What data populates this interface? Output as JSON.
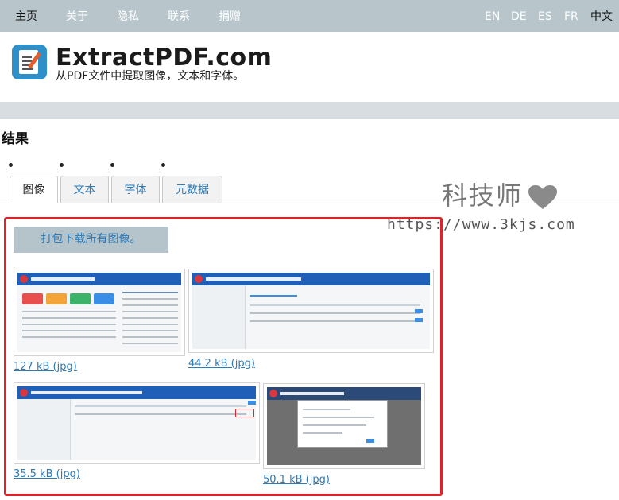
{
  "nav": {
    "left": [
      "主页",
      "关于",
      "隐私",
      "联系",
      "捐赠"
    ],
    "languages": [
      "EN",
      "DE",
      "ES",
      "FR",
      "中文"
    ]
  },
  "header": {
    "title": "ExtractPDF.com",
    "subtitle": "从PDF文件中提取图像，文本和字体。"
  },
  "results": {
    "heading": "结果",
    "tabs": [
      "图像",
      "文本",
      "字体",
      "元数据"
    ],
    "download_all_label": "打包下载所有图像。",
    "images": [
      {
        "size_label": "127 kB (jpg)"
      },
      {
        "size_label": "44.2 kB (jpg)"
      },
      {
        "size_label": "35.5 kB (jpg)"
      },
      {
        "size_label": "50.1 kB (jpg)"
      }
    ]
  },
  "watermark": {
    "text": "科技师",
    "url": "https://www.3kjs.com"
  },
  "colors": {
    "nav_bg": "#b8c6cc",
    "link": "#2c7bb8",
    "highlight_border": "#d9242c"
  }
}
